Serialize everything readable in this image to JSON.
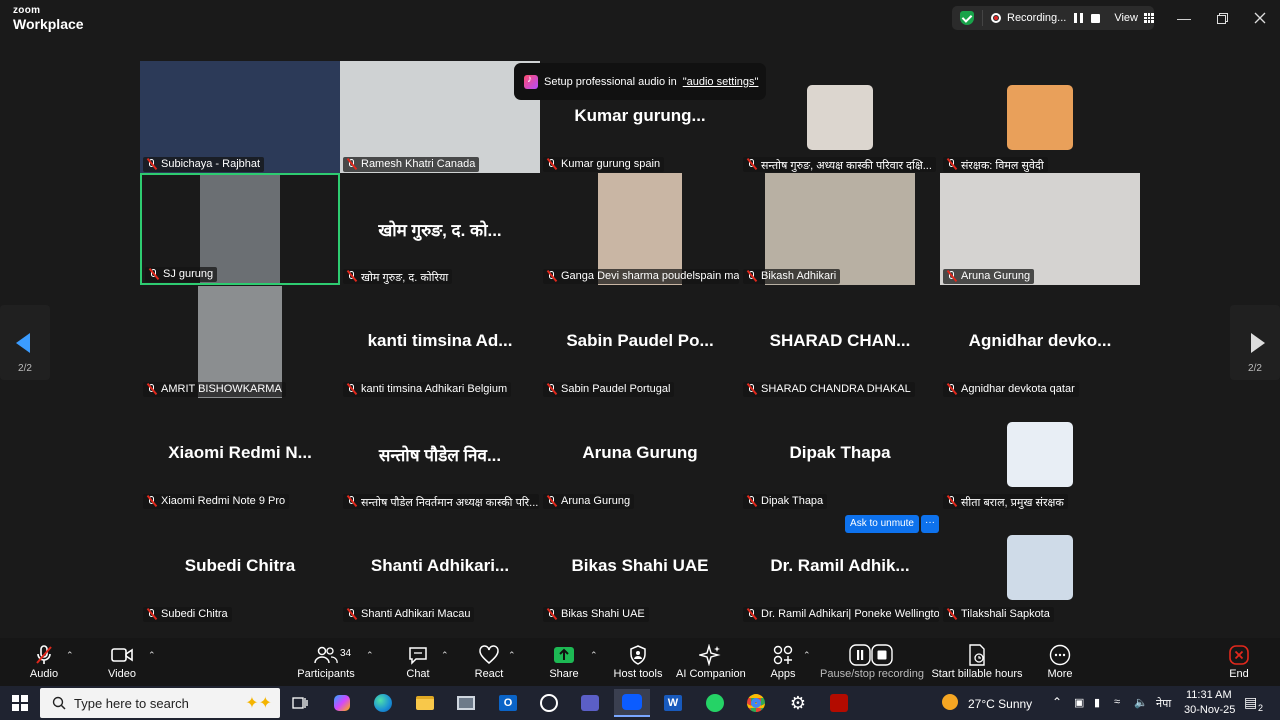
{
  "window": {
    "logo_top": "zoom",
    "logo_bottom": "Workplace",
    "recording_text": "Recording...",
    "view_label": "View"
  },
  "toast": {
    "text": "Setup professional audio in",
    "link": "\"audio settings\""
  },
  "tiles": [
    {
      "label": "Subichaya - Rajbhat",
      "type": "video",
      "bg": "#2c3a58"
    },
    {
      "label": "Ramesh Khatri Canada",
      "type": "video",
      "bg": "#cfd2d3"
    },
    {
      "label": "Kumar gurung spain",
      "type": "name",
      "bigname": "Kumar  gurung..."
    },
    {
      "label": "सन्तोष गुरुङ, अध्यक्ष कास्की परिवार दक्षि...",
      "type": "avatar",
      "bg": "#dcd6cf"
    },
    {
      "label": "संरक्षक: विमल सुवेदी",
      "type": "avatar",
      "bg": "#e9a05a"
    },
    {
      "label": "SJ gurung",
      "type": "video",
      "active": true,
      "bg": "#6b6f73"
    },
    {
      "label": "खोम गुरुङ, द. कोरिया",
      "type": "name",
      "bigname": "खोम गुरुङ, द. को..."
    },
    {
      "label": "Ganga Devi sharma poudelspain ma...",
      "type": "video",
      "bg": "#c9b6a4"
    },
    {
      "label": "Bikash Adhikari",
      "type": "video",
      "bg": "#b8b0a3"
    },
    {
      "label": "Aruna Gurung",
      "type": "video",
      "bg": "#d5d3d1"
    },
    {
      "label": "AMRIT BISHOWKARMA",
      "type": "video",
      "bg": "#8b8e90"
    },
    {
      "label": "kanti timsina Adhikari Belgium",
      "type": "name",
      "bigname": "kanti timsina Ad..."
    },
    {
      "label": "Sabin Paudel Portugal",
      "type": "name",
      "bigname": "Sabin  Paudel  Po..."
    },
    {
      "label": "SHARAD CHANDRA DHAKAL",
      "type": "name",
      "bigname": "SHARAD  CHAN..."
    },
    {
      "label": "Agnidhar devkota qatar",
      "type": "name",
      "bigname": "Agnidhar  devko..."
    },
    {
      "label": "Xiaomi Redmi Note 9 Pro",
      "type": "name",
      "bigname": "Xiaomi  Redmi  N..."
    },
    {
      "label": "सन्तोष पौडेल निवर्तमान अध्यक्ष कास्की परि...",
      "type": "name",
      "bigname": "सन्तोष पौडेल निव..."
    },
    {
      "label": "Aruna Gurung",
      "type": "name",
      "bigname": "Aruna Gurung"
    },
    {
      "label": "Dipak Thapa",
      "type": "name",
      "bigname": "Dipak Thapa"
    },
    {
      "label": "सीता बराल, प्रमुख संरक्षक",
      "type": "avatar",
      "bg": "#e8eef5"
    },
    {
      "label": "Subedi Chitra",
      "type": "name",
      "bigname": "Subedi Chitra"
    },
    {
      "label": "Shanti Adhikari Macau",
      "type": "name",
      "bigname": "Shanti  Adhikari..."
    },
    {
      "label": "Bikas Shahi UAE",
      "type": "name",
      "bigname": "Bikas Shahi UAE"
    },
    {
      "label": "Dr. Ramil Adhikari| Poneke Wellington",
      "type": "name",
      "bigname": "Dr.  Ramil  Adhik..."
    },
    {
      "label": "Tilakshali Sapkota",
      "type": "avatar",
      "bg": "#cfdbe8"
    }
  ],
  "ask_unmute": {
    "label": "Ask to unmute",
    "more": "···"
  },
  "pager": {
    "left": "2/2",
    "right": "2/2"
  },
  "toolbar": {
    "audio": "Audio",
    "video": "Video",
    "participants": "Participants",
    "participants_count": "34",
    "chat": "Chat",
    "react": "React",
    "share": "Share",
    "host_tools": "Host tools",
    "ai_companion": "AI Companion",
    "apps": "Apps",
    "pause_stop": "Pause/stop recording",
    "billable": "Start billable hours",
    "more": "More",
    "end": "End"
  },
  "taskbar": {
    "search_placeholder": "Type here to search",
    "weather": "27°C  Sunny",
    "lang": "नेपा",
    "time": "11:31 AM",
    "date": "30-Nov-25",
    "notif_count": "2"
  }
}
